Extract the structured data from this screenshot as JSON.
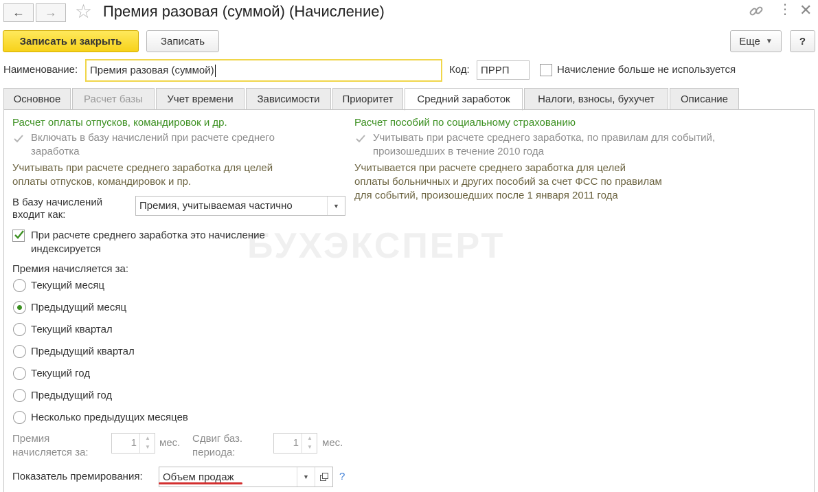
{
  "window": {
    "title": "Премия разовая (суммой) (Начисление)"
  },
  "toolbar": {
    "save_close_label": "Записать и закрыть",
    "save_label": "Записать",
    "more_label": "Еще",
    "help_label": "?"
  },
  "header": {
    "name_label": "Наименование:",
    "name_value": "Премия разовая (суммой)",
    "code_label": "Код:",
    "code_value": "ПРРП",
    "unused_label": "Начисление больше не используется"
  },
  "tabs": [
    {
      "label": "Основное"
    },
    {
      "label": "Расчет базы"
    },
    {
      "label": "Учет времени"
    },
    {
      "label": "Зависимости"
    },
    {
      "label": "Приоритет"
    },
    {
      "label": "Средний заработок"
    },
    {
      "label": "Налоги, взносы, бухучет"
    },
    {
      "label": "Описание"
    }
  ],
  "left": {
    "section_title": "Расчет оплаты отпусков, командировок и др.",
    "include_check_line1": "Включать в базу начислений при расчете среднего",
    "include_check_line2": "заработка",
    "note_line1": "Учитывать при расчете среднего заработка для целей",
    "note_line2": "оплаты отпусков, командировок и пр.",
    "base_label_line1": "В базу начислений",
    "base_label_line2": "входит как:",
    "base_value": "Премия, учитываемая частично",
    "indexed_line1": "При расчете среднего заработка это начисление",
    "indexed_line2": "индексируется",
    "period_title": "Премия начисляется за:",
    "radios": [
      {
        "label": "Текущий месяц",
        "selected": false
      },
      {
        "label": "Предыдущий месяц",
        "selected": true
      },
      {
        "label": "Текущий квартал",
        "selected": false
      },
      {
        "label": "Предыдущий квартал",
        "selected": false
      },
      {
        "label": "Текущий год",
        "selected": false
      },
      {
        "label": "Предыдущий год",
        "selected": false
      },
      {
        "label": "Несколько предыдущих месяцев",
        "selected": false
      }
    ],
    "months_label_line1": "Премия",
    "months_label_line2": "начисляется за:",
    "months_value": "1",
    "months_unit": "мес.",
    "shift_label_line1": "Сдвиг баз.",
    "shift_label_line2": "периода:",
    "shift_value": "1",
    "shift_unit": "мес.",
    "indicator_label": "Показатель премирования:",
    "indicator_value": "Объем продаж",
    "indicator_help": "?"
  },
  "right": {
    "section_title": "Расчет пособий по социальному страхованию",
    "check_line1": "Учитывать при расчете среднего заработка, по правилам для событий,",
    "check_line2": "произошедших в течение 2010 года",
    "note_line1": "Учитывается при расчете среднего заработка для целей",
    "note_line2": "оплаты больничных и других пособий за счет ФСС по правилам",
    "note_line3": "для событий, произошедших после 1 января 2011 года"
  },
  "watermark": "БУХЭКСПЕРТ",
  "colors": {
    "accent_green": "#3a8f1f",
    "primary_yellow": "#f7d21a",
    "focus_border": "#f0d64a",
    "underline_red": "#d32f2f"
  }
}
